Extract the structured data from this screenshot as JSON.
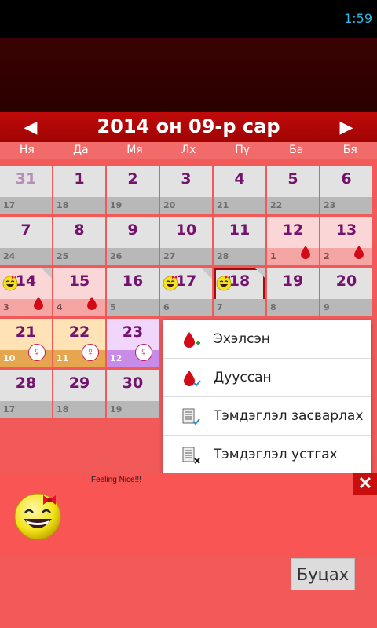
{
  "status_bar": {
    "time": "1:59"
  },
  "month_header": {
    "title": "2014 он 09-р сар",
    "prev_label": "◀",
    "next_label": "▶"
  },
  "weekdays": [
    "Ня",
    "Да",
    "Мя",
    "Лх",
    "Пү",
    "Ба",
    "Бя"
  ],
  "calendar": {
    "rows": [
      [
        {
          "day": "31",
          "sub": "17",
          "style": "gray",
          "faded": true
        },
        {
          "day": "1",
          "sub": "18",
          "style": "gray"
        },
        {
          "day": "2",
          "sub": "19",
          "style": "gray"
        },
        {
          "day": "3",
          "sub": "20",
          "style": "gray"
        },
        {
          "day": "4",
          "sub": "21",
          "style": "gray"
        },
        {
          "day": "5",
          "sub": "22",
          "style": "gray"
        },
        {
          "day": "6",
          "sub": "23",
          "style": "gray"
        }
      ],
      [
        {
          "day": "7",
          "sub": "24",
          "style": "gray"
        },
        {
          "day": "8",
          "sub": "25",
          "style": "gray"
        },
        {
          "day": "9",
          "sub": "26",
          "style": "gray"
        },
        {
          "day": "10",
          "sub": "27",
          "style": "gray"
        },
        {
          "day": "11",
          "sub": "28",
          "style": "gray"
        },
        {
          "day": "12",
          "sub": "1",
          "style": "pink",
          "marker": "drop"
        },
        {
          "day": "13",
          "sub": "2",
          "style": "pink",
          "marker": "drop"
        }
      ],
      [
        {
          "day": "14",
          "sub": "3",
          "style": "pink",
          "marker": "drop",
          "mood": true,
          "fold": true
        },
        {
          "day": "15",
          "sub": "4",
          "style": "pink",
          "marker": "drop"
        },
        {
          "day": "16",
          "sub": "5",
          "style": "gray"
        },
        {
          "day": "17",
          "sub": "6",
          "style": "gray",
          "mood": true,
          "fold": true
        },
        {
          "day": "18",
          "sub": "7",
          "style": "gray",
          "mood": true,
          "fold": true,
          "selected": true
        },
        {
          "day": "19",
          "sub": "8",
          "style": "gray"
        },
        {
          "day": "20",
          "sub": "9",
          "style": "gray"
        }
      ],
      [
        {
          "day": "21",
          "sub": "10",
          "style": "orange",
          "marker": "venus"
        },
        {
          "day": "22",
          "sub": "11",
          "style": "orange",
          "marker": "venus"
        },
        {
          "day": "23",
          "sub": "12",
          "style": "purple",
          "marker": "venus"
        }
      ],
      [
        {
          "day": "28",
          "sub": "17",
          "style": "gray"
        },
        {
          "day": "29",
          "sub": "18",
          "style": "gray"
        },
        {
          "day": "30",
          "sub": "19",
          "style": "gray"
        }
      ]
    ]
  },
  "popup_menu": {
    "items": [
      {
        "label": "Эхэлсэн",
        "icon": "drop-plus-icon"
      },
      {
        "label": "Дууссан",
        "icon": "drop-check-icon"
      },
      {
        "label": "Тэмдэглэл засварлах",
        "icon": "note-edit-icon"
      },
      {
        "label": "Тэмдэглэл устгах",
        "icon": "note-delete-icon"
      }
    ]
  },
  "note_panel": {
    "text": "Feeling Nice!!!",
    "close_label": "✕"
  },
  "footer": {
    "back_label": "Буцах"
  },
  "colors": {
    "accent": "#c00a0a",
    "grid_bg": "#f25a5a",
    "day_text": "#74136f"
  }
}
